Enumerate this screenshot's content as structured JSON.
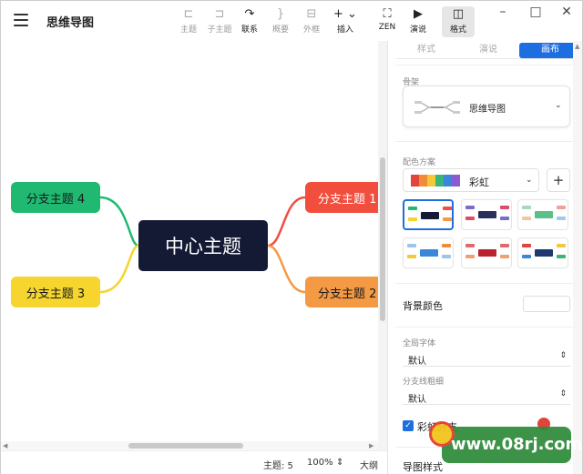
{
  "app": {
    "title": "思维导图"
  },
  "toolbar": {
    "items": [
      {
        "label": "主题",
        "icon": "topic-icon"
      },
      {
        "label": "子主题",
        "icon": "subtopic-icon"
      },
      {
        "label": "联系",
        "icon": "relationship-icon"
      },
      {
        "label": "概要",
        "icon": "summary-icon"
      },
      {
        "label": "外框",
        "icon": "boundary-icon"
      },
      {
        "label": "插入",
        "icon": "insert-icon"
      },
      {
        "label": "ZEN",
        "icon": "zen-icon"
      },
      {
        "label": "演说",
        "icon": "pitch-icon"
      },
      {
        "label": "格式",
        "icon": "format-icon"
      }
    ]
  },
  "mindmap": {
    "center": "中心主题",
    "branches": [
      "分支主题 1",
      "分支主题 2",
      "分支主题 3",
      "分支主题 4"
    ],
    "colors": {
      "center": "#141a33",
      "b1": "#f14e3e",
      "b2": "#f49a45",
      "b3": "#f5d52e",
      "b4": "#1fb971"
    }
  },
  "status": {
    "topics": "主题: 5",
    "zoom": "100%",
    "outline": "大纲"
  },
  "panel": {
    "tabs": [
      "样式",
      "演说",
      "画布"
    ],
    "selected_tab": "画布",
    "structure_label": "骨架",
    "structure_value": "思维导图",
    "color_scheme_label": "配色方案",
    "color_scheme_value": "彩虹",
    "plus": "+",
    "background_label": "背景颜色",
    "global_font_label": "全局字体",
    "global_font_value": "默认",
    "branch_width_label": "分支线粗细",
    "branch_width_value": "默认",
    "rainbow_branch_label": "彩虹分支",
    "map_style_label": "导图样式"
  },
  "watermark": {
    "text": "www.08rj.com"
  }
}
